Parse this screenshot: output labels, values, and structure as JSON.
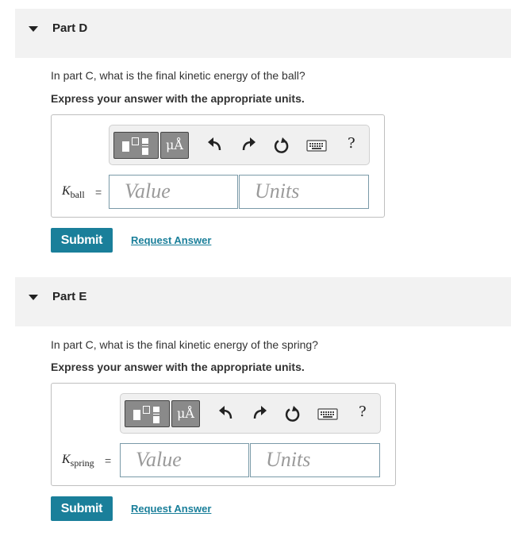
{
  "parts": [
    {
      "title": "Part D",
      "question": "In part C, what is the final kinetic energy of the ball?",
      "instruction": "Express your answer with the appropriate units.",
      "variable": {
        "symbol": "K",
        "subscript": "ball",
        "equals": "="
      },
      "value_placeholder": "Value",
      "units_placeholder": "Units",
      "toolbar": {
        "units_label": "μÅ",
        "help_label": "?"
      },
      "submit_label": "Submit",
      "request_label": "Request Answer"
    },
    {
      "title": "Part E",
      "question": "In part C, what is the final kinetic energy of the spring?",
      "instruction": "Express your answer with the appropriate units.",
      "variable": {
        "symbol": "K",
        "subscript": "spring",
        "equals": "="
      },
      "value_placeholder": "Value",
      "units_placeholder": "Units",
      "toolbar": {
        "units_label": "μÅ",
        "help_label": "?"
      },
      "submit_label": "Submit",
      "request_label": "Request Answer"
    }
  ],
  "colors": {
    "accent": "#1a7f9a",
    "header_bg": "#f2f2f2"
  }
}
